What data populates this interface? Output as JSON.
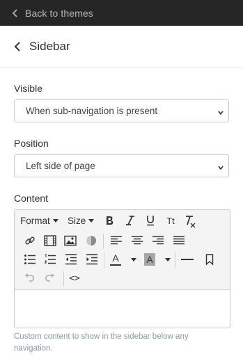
{
  "topbar": {
    "back_label": "Back to themes"
  },
  "header": {
    "title": "Sidebar"
  },
  "visible": {
    "label": "Visible",
    "value": "When sub-navigation is present"
  },
  "position": {
    "label": "Position",
    "value": "Left side of page"
  },
  "content": {
    "label": "Content",
    "toolbar": {
      "format_label": "Format",
      "size_label": "Size",
      "underline_glyph": "U",
      "text_transform_glyph": "Tt",
      "text_color_glyph": "A",
      "bg_color_glyph": "A",
      "source_glyph": "<>"
    },
    "help_text": "Custom content to show in the sidebar below any navigation."
  },
  "icons": [
    "chevron-left-icon",
    "back-arrow-icon",
    "bold-icon",
    "italic-icon",
    "underline-icon",
    "text-transform-icon",
    "clear-format-icon",
    "link-icon",
    "video-icon",
    "image-icon",
    "contrast-icon",
    "align-left-icon",
    "align-center-icon",
    "align-right-icon",
    "justify-icon",
    "bullet-list-icon",
    "numbered-list-icon",
    "outdent-icon",
    "indent-icon",
    "text-color-icon",
    "background-color-icon",
    "horizontal-rule-icon",
    "bookmark-icon",
    "undo-icon",
    "redo-icon",
    "source-code-icon"
  ],
  "colors": {
    "topbar_bg": "#262626",
    "help_text": "#8a9aa7",
    "toolbar_bg": "#f4f4f4"
  }
}
